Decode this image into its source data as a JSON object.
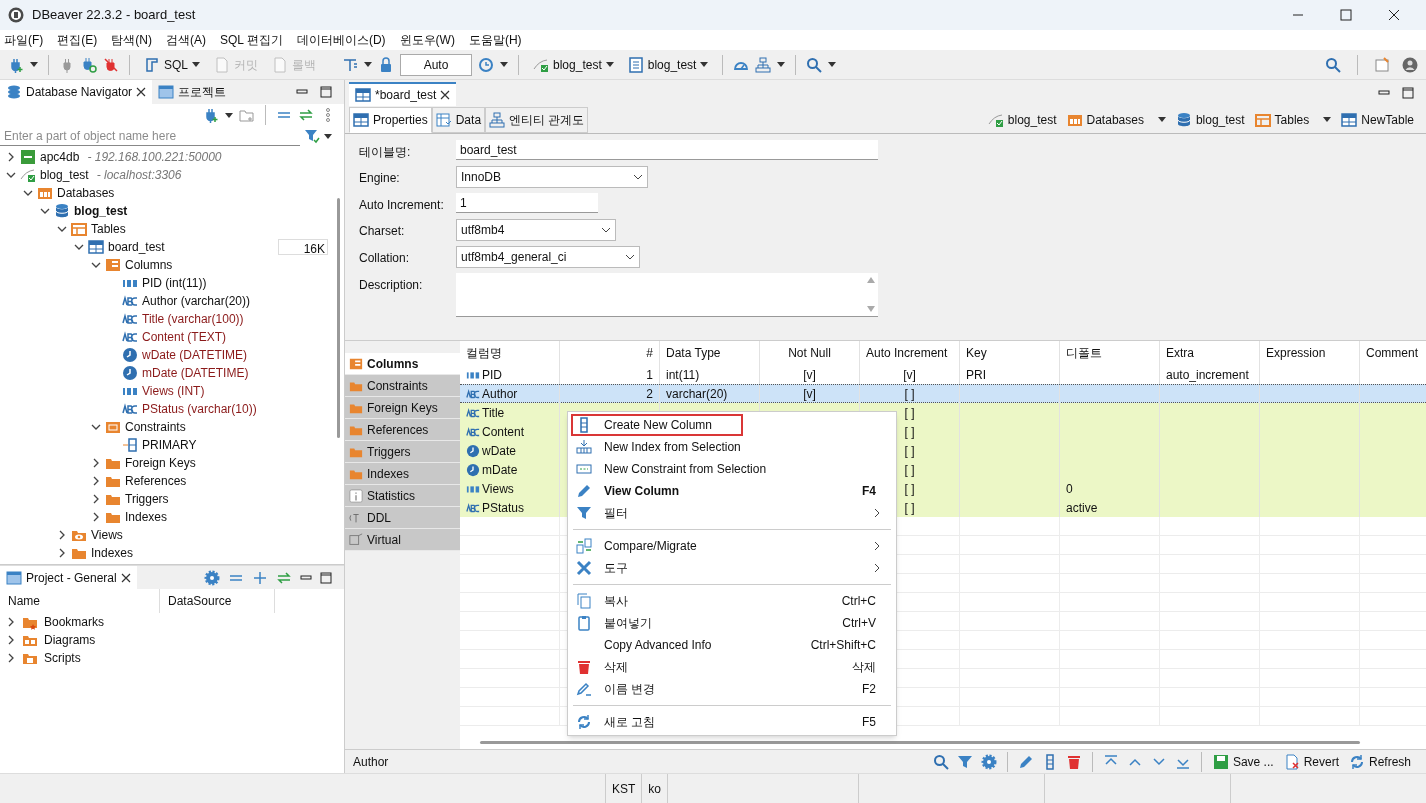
{
  "window": {
    "title": "DBeaver 22.3.2 - board_test"
  },
  "menu": [
    "파일(F)",
    "편집(E)",
    "탐색(N)",
    "검색(A)",
    "SQL 편집기",
    "데이터베이스(D)",
    "윈도우(W)",
    "도움말(H)"
  ],
  "toolbar": {
    "buttons": [
      {
        "label": "SQL",
        "disabled": false
      },
      {
        "label": "커밋",
        "disabled": true
      },
      {
        "label": "롤백",
        "disabled": true
      },
      {
        "label": "blog_test",
        "disabled": false
      },
      {
        "label": "blog_test",
        "disabled": false
      }
    ],
    "mode_field": "Auto"
  },
  "navigator": {
    "tabs": [
      {
        "label": "Database Navigator",
        "selected": true
      },
      {
        "label": "프로젝트",
        "selected": false
      }
    ],
    "search_placeholder": "Enter a part of object name here",
    "tree": [
      {
        "label": "apc4db",
        "detail": "- 192.168.100.221:50000",
        "kind": "db2",
        "expanded": false
      },
      {
        "label": "blog_test",
        "detail": "- localhost:3306",
        "kind": "connection",
        "expanded": true,
        "children": [
          {
            "label": "Databases",
            "kind": "databases",
            "expanded": true,
            "children": [
              {
                "label": "blog_test",
                "kind": "database",
                "bold": true,
                "expanded": true,
                "children": [
                  {
                    "label": "Tables",
                    "kind": "tables",
                    "expanded": true,
                    "children": [
                      {
                        "label": "board_test",
                        "kind": "table",
                        "badge": "16K",
                        "expanded": true,
                        "children": [
                          {
                            "label": "Columns",
                            "kind": "columns",
                            "expanded": true,
                            "children": [
                              {
                                "label": "PID (int(11))",
                                "kind": "number",
                                "new": false
                              },
                              {
                                "label": "Author (varchar(20))",
                                "kind": "text",
                                "new": false
                              },
                              {
                                "label": "Title (varchar(100))",
                                "kind": "text",
                                "new": true
                              },
                              {
                                "label": "Content (TEXT)",
                                "kind": "text",
                                "new": true
                              },
                              {
                                "label": "wDate (DATETIME)",
                                "kind": "datetime",
                                "new": true
                              },
                              {
                                "label": "mDate (DATETIME)",
                                "kind": "datetime",
                                "new": true
                              },
                              {
                                "label": "Views (INT)",
                                "kind": "number",
                                "new": true
                              },
                              {
                                "label": "PStatus (varchar(10))",
                                "kind": "text",
                                "new": true
                              }
                            ]
                          },
                          {
                            "label": "Constraints",
                            "kind": "constraints",
                            "expanded": true,
                            "children": [
                              {
                                "label": "PRIMARY",
                                "kind": "key"
                              }
                            ]
                          },
                          {
                            "label": "Foreign Keys",
                            "kind": "folder",
                            "expanded": false
                          },
                          {
                            "label": "References",
                            "kind": "folder",
                            "expanded": false
                          },
                          {
                            "label": "Triggers",
                            "kind": "folder",
                            "expanded": false
                          },
                          {
                            "label": "Indexes",
                            "kind": "folder",
                            "expanded": false
                          }
                        ]
                      }
                    ]
                  },
                  {
                    "label": "Views",
                    "kind": "views",
                    "expanded": false
                  },
                  {
                    "label": "Indexes",
                    "kind": "folder",
                    "expanded": false
                  }
                ]
              }
            ]
          }
        ]
      }
    ]
  },
  "project": {
    "title": "Project - General",
    "columns": [
      "Name",
      "DataSource"
    ],
    "items": [
      {
        "label": "Bookmarks",
        "expanded": false
      },
      {
        "label": "Diagrams",
        "expanded": false
      },
      {
        "label": "Scripts",
        "expanded": false
      }
    ]
  },
  "editor": {
    "tab": "*board_test",
    "subtabs": [
      {
        "label": "Properties",
        "selected": true
      },
      {
        "label": "Data",
        "selected": false
      },
      {
        "label": "엔티티 관계도",
        "selected": false
      }
    ],
    "breadcrumbs": [
      {
        "label": "blog_test",
        "dropdown": false
      },
      {
        "label": "Databases",
        "dropdown": true
      },
      {
        "label": "blog_test",
        "dropdown": false
      },
      {
        "label": "Tables",
        "dropdown": true
      },
      {
        "label": "NewTable",
        "dropdown": false
      }
    ],
    "fields": [
      {
        "label": "테이블명:",
        "value": "board_test",
        "kind": "text"
      },
      {
        "label": "Engine:",
        "value": "InnoDB",
        "kind": "select"
      },
      {
        "label": "Auto Increment:",
        "value": "1",
        "kind": "text"
      },
      {
        "label": "Charset:",
        "value": "utf8mb4",
        "kind": "select"
      },
      {
        "label": "Collation:",
        "value": "utf8mb4_general_ci",
        "kind": "select"
      },
      {
        "label": "Description:",
        "kind": "textarea"
      }
    ],
    "side_tabs": [
      {
        "label": "Columns",
        "selected": true
      },
      {
        "label": "Constraints",
        "selected": false
      },
      {
        "label": "Foreign Keys",
        "selected": false
      },
      {
        "label": "References",
        "selected": false
      },
      {
        "label": "Triggers",
        "selected": false
      },
      {
        "label": "Indexes",
        "selected": false
      },
      {
        "label": "Statistics",
        "selected": false
      },
      {
        "label": "DDL",
        "selected": false
      },
      {
        "label": "Virtual",
        "selected": false
      }
    ],
    "table": {
      "columns": [
        "컬럼명",
        "#",
        "Data Type",
        "Not Null",
        "Auto Increment",
        "Key",
        "디폴트",
        "Extra",
        "Expression",
        "Comment"
      ],
      "rows": [
        {
          "kind": "number",
          "name": "PID",
          "number": "1",
          "data_type": "int(11)",
          "not_null": "[v]",
          "auto_increment": "[v]",
          "key": "PRI",
          "extra": "auto_increment",
          "selected": false,
          "new": false
        },
        {
          "kind": "text",
          "name": "Author",
          "number": "2",
          "data_type": "varchar(20)",
          "not_null": "[v]",
          "auto_increment": "[ ]",
          "selected": true,
          "new": false
        },
        {
          "kind": "text",
          "name": "Title",
          "auto_increment": "[ ]",
          "selected": false,
          "new": true
        },
        {
          "kind": "text",
          "name": "Content",
          "auto_increment": "[ ]",
          "selected": false,
          "new": true
        },
        {
          "kind": "datetime",
          "name": "wDate",
          "auto_increment": "[ ]",
          "selected": false,
          "new": true
        },
        {
          "kind": "datetime",
          "name": "mDate",
          "auto_increment": "[ ]",
          "selected": false,
          "new": true
        },
        {
          "kind": "number",
          "name": "Views",
          "auto_increment": "[ ]",
          "default": "0",
          "selected": false,
          "new": true
        },
        {
          "kind": "text",
          "name": "PStatus",
          "auto_increment": "[ ]",
          "default": "active",
          "selected": false,
          "new": true
        }
      ]
    },
    "context_menu": [
      {
        "kind": "item",
        "label": "Create New Column",
        "bold": false,
        "submenu": false,
        "focused": true
      },
      {
        "kind": "item",
        "label": "New Index from Selection",
        "bold": false,
        "submenu": false,
        "focused": false
      },
      {
        "kind": "item",
        "label": "New Constraint from Selection",
        "bold": false,
        "submenu": false,
        "focused": false
      },
      {
        "kind": "item",
        "label": "View Column",
        "shortcut": "F4",
        "bold": true,
        "submenu": false,
        "focused": false
      },
      {
        "kind": "item",
        "label": "필터",
        "bold": false,
        "submenu": true,
        "focused": false
      },
      {
        "kind": "separator"
      },
      {
        "kind": "item",
        "label": "Compare/Migrate",
        "bold": false,
        "submenu": true,
        "focused": false
      },
      {
        "kind": "item",
        "label": "도구",
        "bold": false,
        "submenu": true,
        "focused": false
      },
      {
        "kind": "separator"
      },
      {
        "kind": "item",
        "label": "복사",
        "shortcut": "Ctrl+C",
        "bold": false,
        "submenu": false,
        "focused": false
      },
      {
        "kind": "item",
        "label": "붙여넣기",
        "shortcut": "Ctrl+V",
        "bold": false,
        "submenu": false,
        "focused": false
      },
      {
        "kind": "item",
        "label": "Copy Advanced Info",
        "shortcut": "Ctrl+Shift+C",
        "bold": false,
        "submenu": false,
        "focused": false
      },
      {
        "kind": "item",
        "label": "삭제",
        "shortcut": "삭제",
        "bold": false,
        "submenu": false,
        "focused": false
      },
      {
        "kind": "item",
        "label": "이름 변경",
        "shortcut": "F2",
        "bold": false,
        "submenu": false,
        "focused": false
      },
      {
        "kind": "separator"
      },
      {
        "kind": "item",
        "label": "새로 고침",
        "shortcut": "F5",
        "bold": false,
        "submenu": false,
        "focused": false
      }
    ]
  },
  "editor_status": {
    "text": "Author",
    "buttons": [
      "Save ...",
      "Revert",
      "Refresh"
    ]
  },
  "status_bar": [
    "KST",
    "ko"
  ]
}
